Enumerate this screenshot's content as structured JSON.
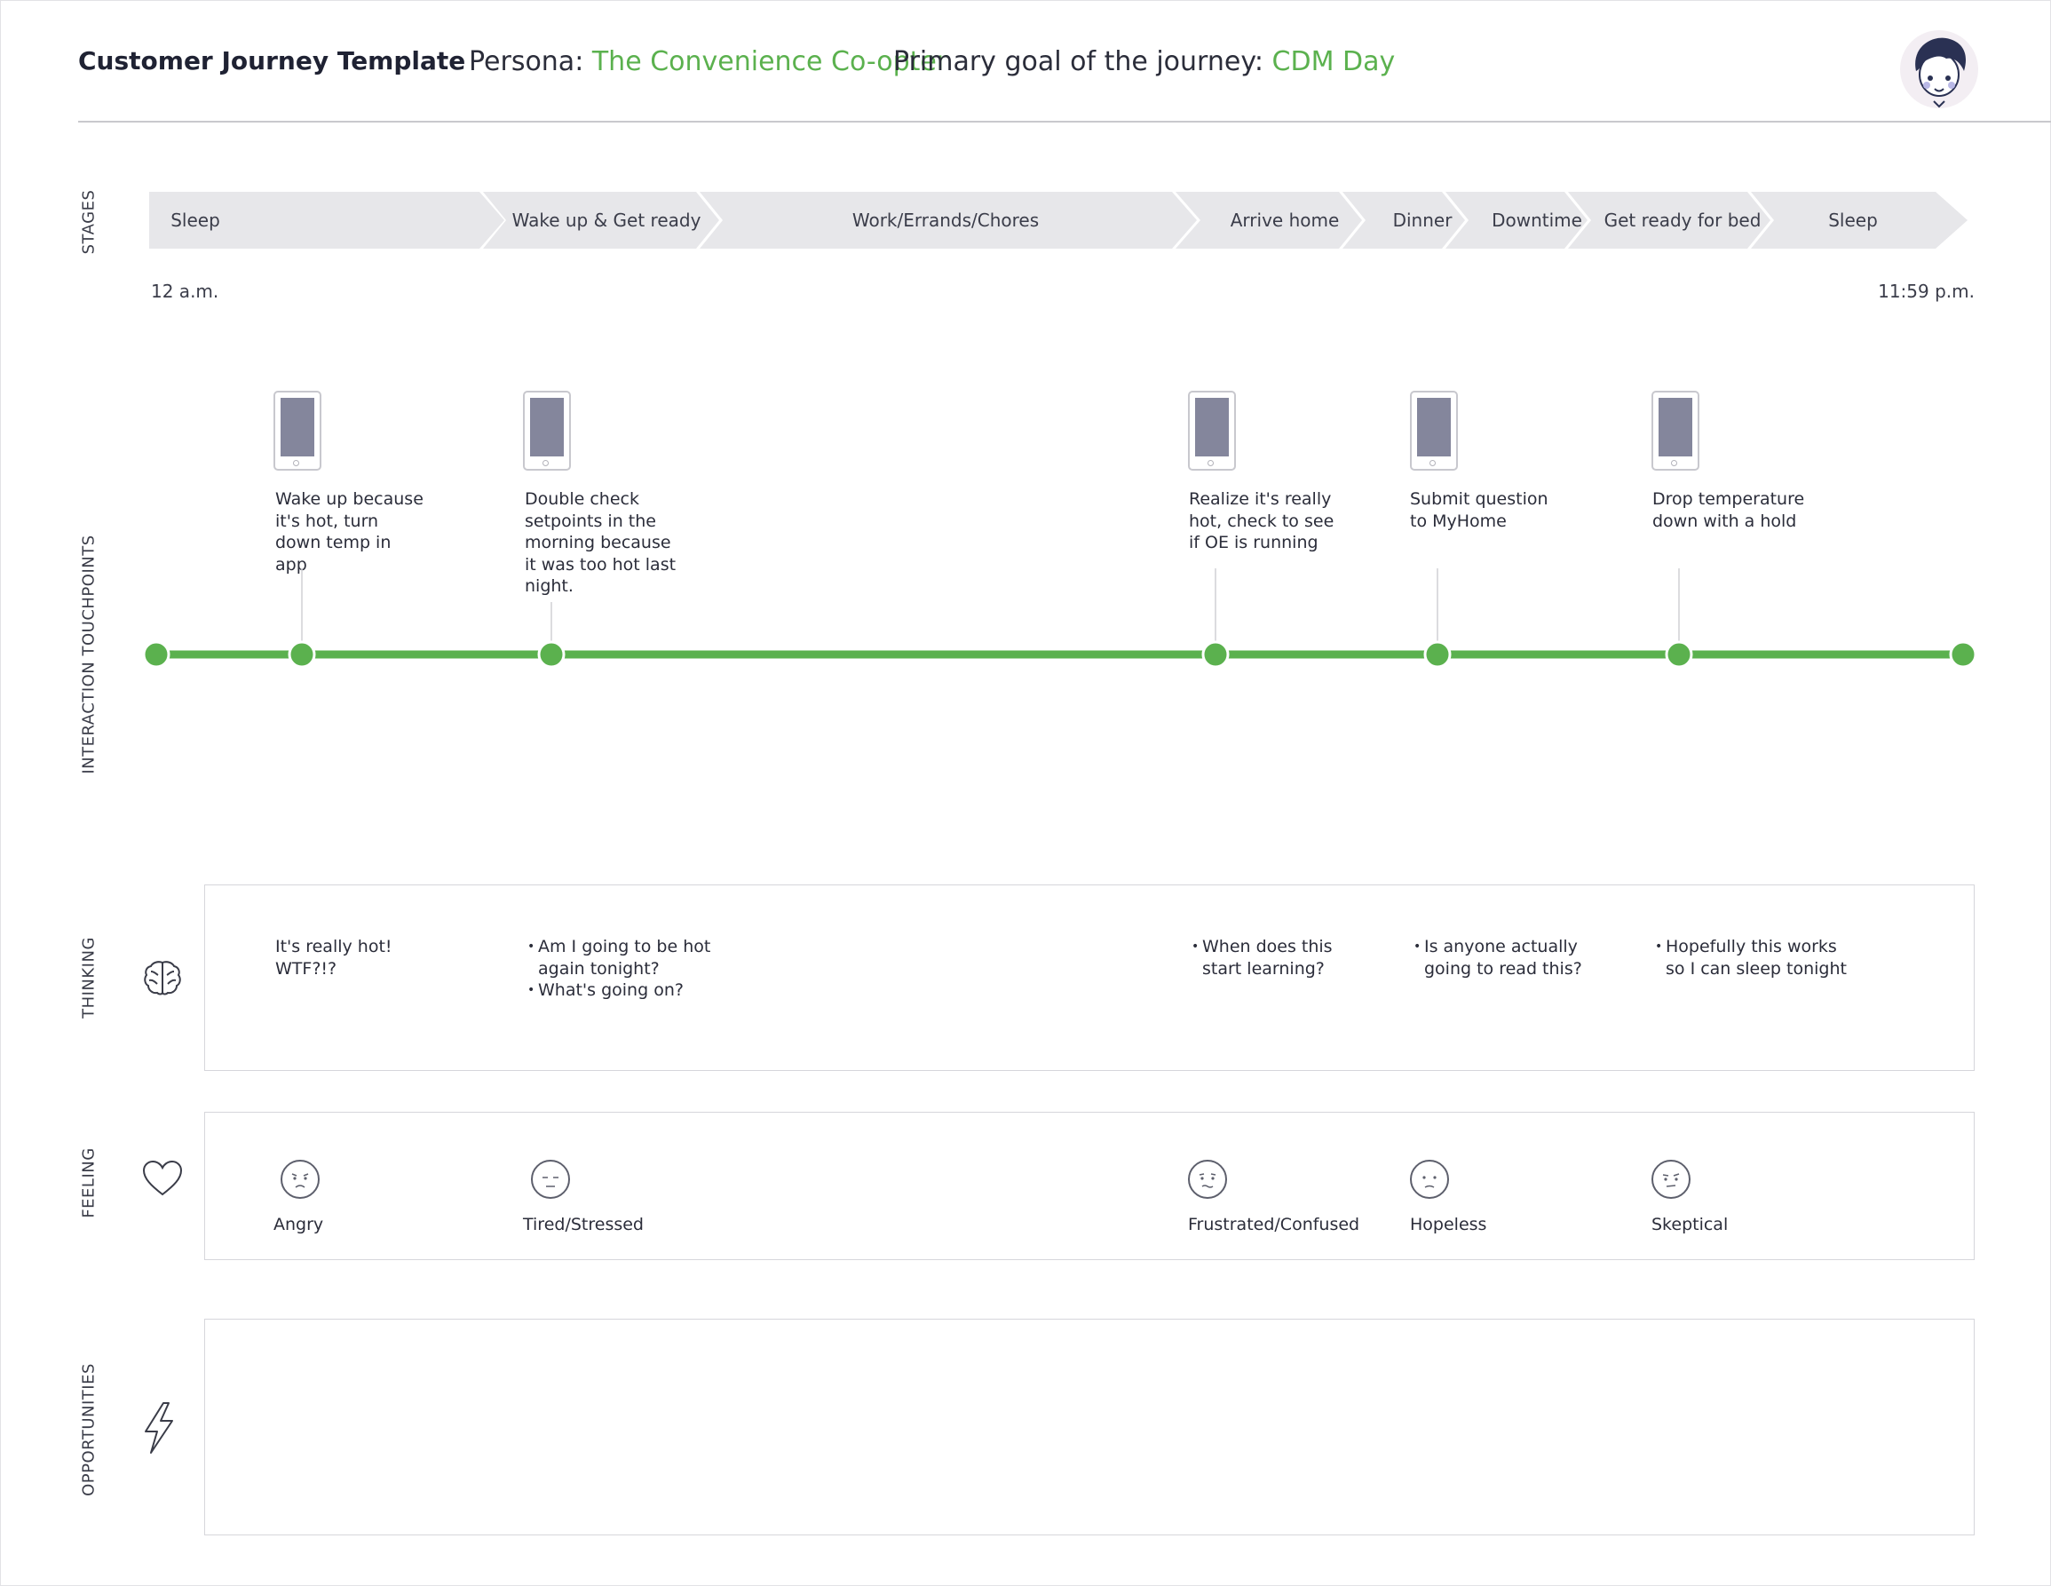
{
  "header": {
    "title": "Customer Journey Template",
    "persona_label": "Persona:",
    "persona_value": "The Convenience Co-opter",
    "goal_label": "Primary goal of the journey:",
    "goal_value": "CDM Day"
  },
  "rows": {
    "stages": "STAGES",
    "touchpoints": "INTERACTION TOUCHPOINTS",
    "thinking": "THINKING",
    "feeling": "FEELING",
    "opportunities": "OPPORTUNITIES"
  },
  "stages": [
    "Sleep",
    "Wake up & Get ready",
    "Work/Errands/Chores",
    "Arrive home",
    "Dinner",
    "Downtime",
    "Get ready for bed",
    "Sleep"
  ],
  "times": {
    "start": "12 a.m.",
    "end": "11:59 p.m."
  },
  "touchpoints": [
    "Wake up because it's hot, turn down temp in app",
    "Double check setpoints in the morning because it was too hot last night.",
    "Realize it's really hot, check to see if OE is running",
    "Submit question to MyHome",
    "Drop temperature down with a hold"
  ],
  "thinking": [
    {
      "lines": [
        "It's really hot!",
        "WTF?!?"
      ],
      "bullets": false
    },
    {
      "lines": [
        "Am I going to be hot",
        "again tonight?",
        "What's going on?"
      ],
      "bullets": true
    },
    {
      "lines": [
        "When does this",
        "start learning?"
      ],
      "bullets": true
    },
    {
      "lines": [
        "Is anyone actually",
        "going to read this?"
      ],
      "bullets": true
    },
    {
      "lines": [
        "Hopefully this works",
        "so I can sleep tonight"
      ],
      "bullets": true
    }
  ],
  "feelings": [
    "Angry",
    "Tired/Stressed",
    "Frustrated/Confused",
    "Hopeless",
    "Skeptical"
  ],
  "icons": {
    "thinking": "brain-icon",
    "feeling": "heart-icon",
    "opportunities": "lightning-icon",
    "touchpoint": "phone-icon",
    "feeling_face": "face-icon"
  },
  "colors": {
    "accent": "#5bb14e",
    "stage_fill": "#e7e7ea",
    "phone_screen": "#84869c"
  }
}
